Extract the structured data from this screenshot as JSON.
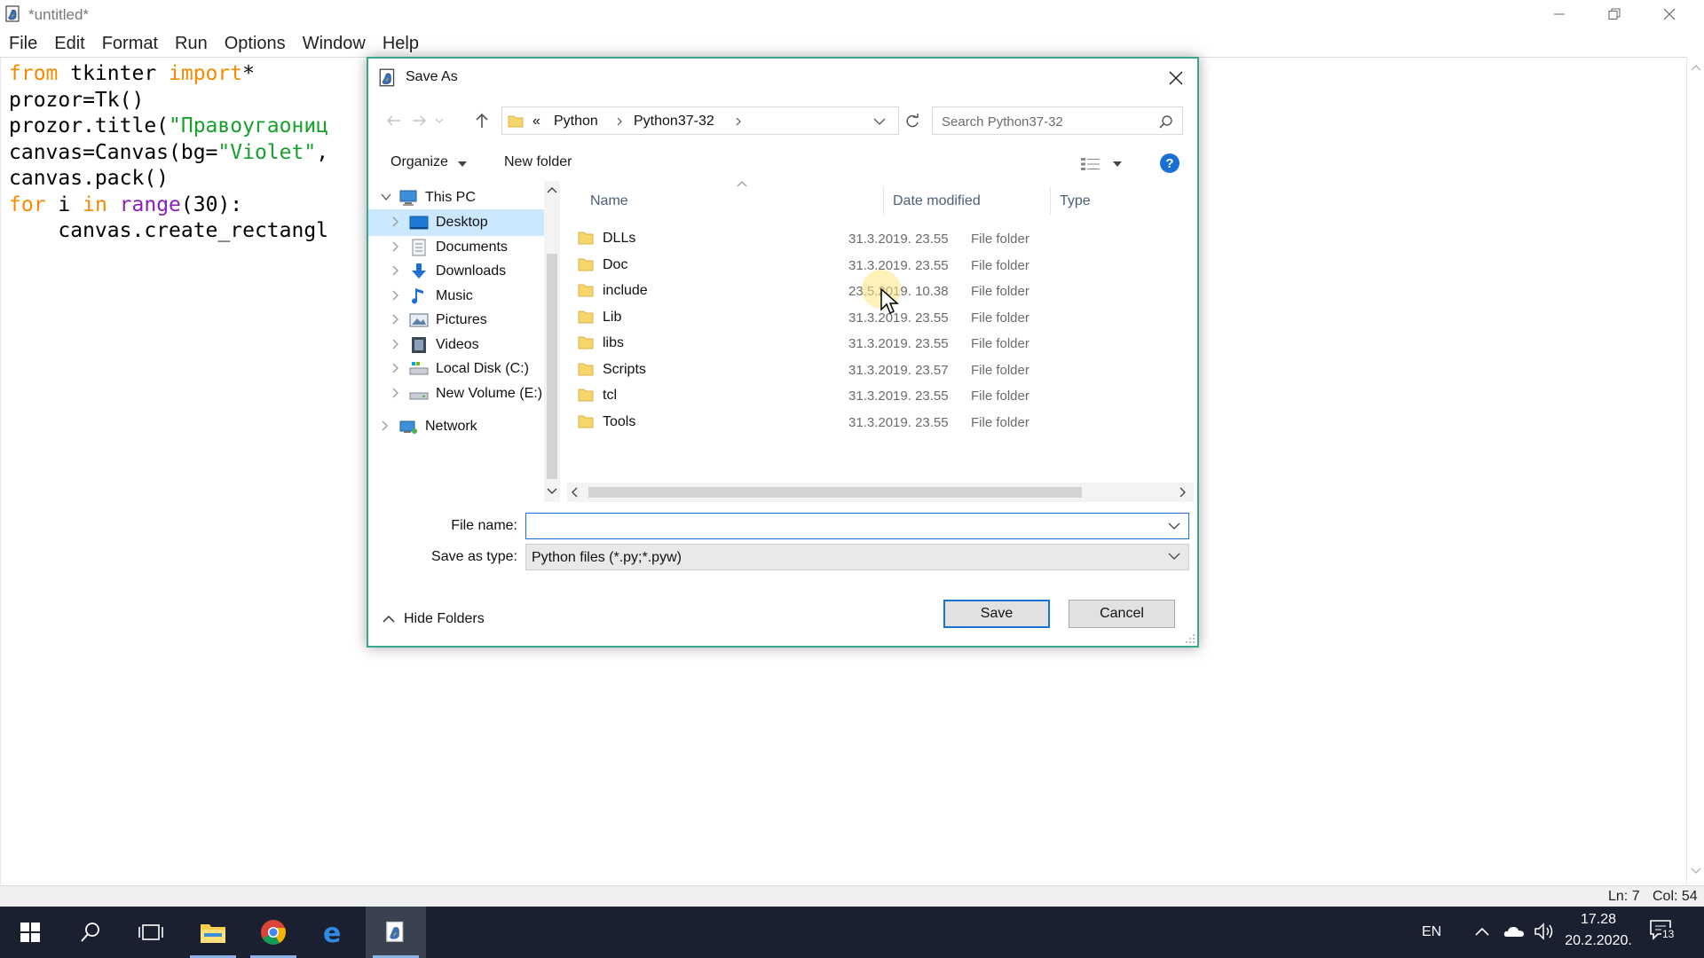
{
  "window": {
    "title": "*untitled*",
    "menu": [
      "File",
      "Edit",
      "Format",
      "Run",
      "Options",
      "Window",
      "Help"
    ]
  },
  "editor": {
    "lines": [
      [
        {
          "t": "from",
          "c": "kw"
        },
        {
          "t": " tkinter ",
          "c": ""
        },
        {
          "t": "import",
          "c": "kw"
        },
        {
          "t": "*",
          "c": ""
        }
      ],
      [
        {
          "t": "prozor=Tk()",
          "c": ""
        }
      ],
      [
        {
          "t": "prozor.title(",
          "c": ""
        },
        {
          "t": "\"Правоугаониц",
          "c": "str"
        }
      ],
      [
        {
          "t": "canvas=Canvas(bg=",
          "c": ""
        },
        {
          "t": "\"Violet\"",
          "c": "str"
        },
        {
          "t": ",",
          "c": ""
        }
      ],
      [
        {
          "t": "canvas.pack()",
          "c": ""
        }
      ],
      [
        {
          "t": "for",
          "c": "kw"
        },
        {
          "t": " i ",
          "c": ""
        },
        {
          "t": "in",
          "c": "kw"
        },
        {
          "t": " ",
          "c": ""
        },
        {
          "t": "range",
          "c": "bi"
        },
        {
          "t": "(30):",
          "c": ""
        }
      ],
      [
        {
          "t": "    canvas.create_rectangl",
          "c": ""
        }
      ]
    ]
  },
  "status": {
    "line": "Ln: 7",
    "col": "Col: 54"
  },
  "dialog": {
    "title": "Save As",
    "breadcrumb": [
      "«",
      "Python",
      "Python37-32"
    ],
    "search_placeholder": "Search Python37-32",
    "organize_label": "Organize",
    "new_folder_label": "New folder",
    "help_label": "?",
    "nav_items": [
      {
        "label": "This PC",
        "icon": "computer-icon",
        "indent": 0,
        "expanded": true
      },
      {
        "label": "Desktop",
        "icon": "desktop-icon",
        "indent": 1,
        "selected": true
      },
      {
        "label": "Documents",
        "icon": "documents-icon",
        "indent": 1
      },
      {
        "label": "Downloads",
        "icon": "downloads-icon",
        "indent": 1
      },
      {
        "label": "Music",
        "icon": "music-icon",
        "indent": 1
      },
      {
        "label": "Pictures",
        "icon": "pictures-icon",
        "indent": 1
      },
      {
        "label": "Videos",
        "icon": "videos-icon",
        "indent": 1
      },
      {
        "label": "Local Disk (C:)",
        "icon": "local-disk-icon",
        "indent": 1
      },
      {
        "label": "New Volume (E:)",
        "icon": "drive-icon",
        "indent": 1
      },
      {
        "label": "Network",
        "icon": "network-icon",
        "indent": 0
      }
    ],
    "columns": {
      "name": "Name",
      "date": "Date modified",
      "type": "Type"
    },
    "files": [
      {
        "name": "DLLs",
        "date": "31.3.2019. 23.55",
        "type": "File folder"
      },
      {
        "name": "Doc",
        "date": "31.3.2019. 23.55",
        "type": "File folder"
      },
      {
        "name": "include",
        "date": "23.5.2019. 10.38",
        "type": "File folder"
      },
      {
        "name": "Lib",
        "date": "31.3.2019. 23.55",
        "type": "File folder"
      },
      {
        "name": "libs",
        "date": "31.3.2019. 23.55",
        "type": "File folder"
      },
      {
        "name": "Scripts",
        "date": "31.3.2019. 23.57",
        "type": "File folder"
      },
      {
        "name": "tcl",
        "date": "31.3.2019. 23.55",
        "type": "File folder"
      },
      {
        "name": "Tools",
        "date": "31.3.2019. 23.55",
        "type": "File folder"
      }
    ],
    "file_name_label": "File name:",
    "file_name_value": "",
    "save_type_label": "Save as type:",
    "save_type_value": "Python files (*.py;*.pyw)",
    "hide_folders_label": "Hide Folders",
    "save_label": "Save",
    "cancel_label": "Cancel"
  },
  "taskbar": {
    "lang": "EN",
    "time": "17.28",
    "date": "20.2.2020.",
    "notifications": "13"
  },
  "colors": {
    "accent": "#1a73d4",
    "dialog_border": "#3aa88e",
    "taskbar": "#1b2030",
    "keyword": "#f58a00",
    "string": "#17a12c",
    "builtin": "#8b1fb5"
  }
}
